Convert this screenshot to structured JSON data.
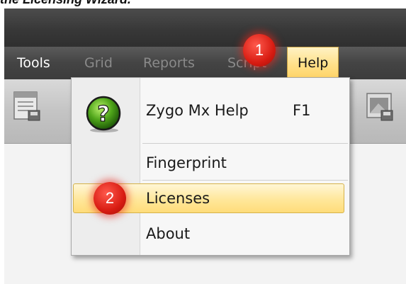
{
  "caption": "the Licensing Wizard.",
  "menu": [
    {
      "label": "Tools",
      "state": "enabled"
    },
    {
      "label": "Grid",
      "state": "disabled"
    },
    {
      "label": "Reports",
      "state": "disabled"
    },
    {
      "label": "Script",
      "state": "disabled"
    },
    {
      "label": "Help",
      "state": "open"
    }
  ],
  "help_menu": {
    "items": [
      {
        "label": "Zygo Mx Help",
        "shortcut": "F1",
        "icon": "question-icon"
      },
      {
        "label": "Fingerprint"
      },
      {
        "label": "Licenses",
        "highlighted": true
      },
      {
        "label": "About"
      }
    ]
  },
  "callouts": [
    "1",
    "2"
  ],
  "colors": {
    "menubar": "#444444",
    "open_menu_highlight": "#ffe089",
    "callout": "#d81c12"
  }
}
